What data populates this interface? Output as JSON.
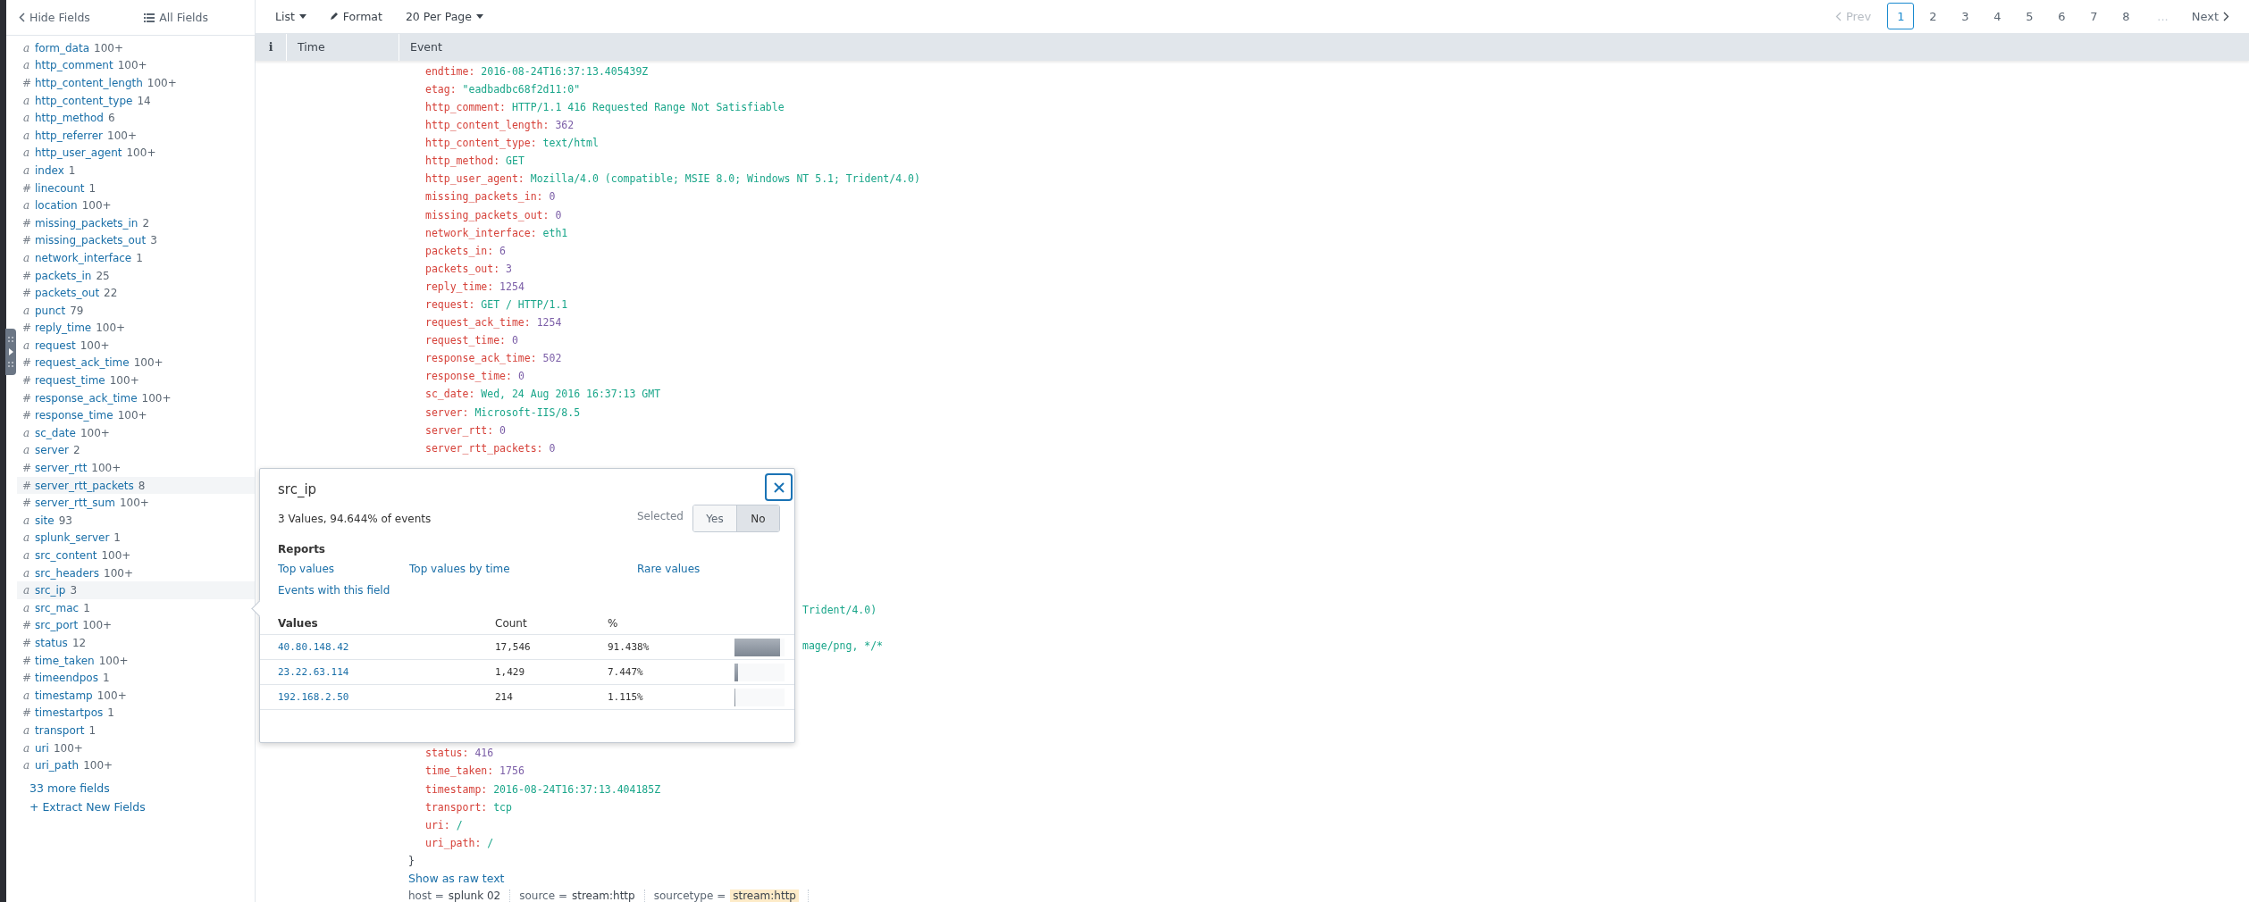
{
  "sidebar": {
    "hide_fields": "Hide Fields",
    "all_fields": "All Fields",
    "fields": [
      {
        "type": "a",
        "name": "form_data",
        "count": "100+",
        "highlighted": false
      },
      {
        "type": "a",
        "name": "http_comment",
        "count": "100+",
        "highlighted": false
      },
      {
        "type": "#",
        "name": "http_content_length",
        "count": "100+",
        "highlighted": false
      },
      {
        "type": "a",
        "name": "http_content_type",
        "count": "14",
        "highlighted": false
      },
      {
        "type": "a",
        "name": "http_method",
        "count": "6",
        "highlighted": false
      },
      {
        "type": "a",
        "name": "http_referrer",
        "count": "100+",
        "highlighted": false
      },
      {
        "type": "a",
        "name": "http_user_agent",
        "count": "100+",
        "highlighted": false
      },
      {
        "type": "a",
        "name": "index",
        "count": "1",
        "highlighted": false
      },
      {
        "type": "#",
        "name": "linecount",
        "count": "1",
        "highlighted": false
      },
      {
        "type": "a",
        "name": "location",
        "count": "100+",
        "highlighted": false
      },
      {
        "type": "#",
        "name": "missing_packets_in",
        "count": "2",
        "highlighted": false
      },
      {
        "type": "#",
        "name": "missing_packets_out",
        "count": "3",
        "highlighted": false
      },
      {
        "type": "a",
        "name": "network_interface",
        "count": "1",
        "highlighted": false
      },
      {
        "type": "#",
        "name": "packets_in",
        "count": "25",
        "highlighted": false
      },
      {
        "type": "#",
        "name": "packets_out",
        "count": "22",
        "highlighted": false
      },
      {
        "type": "a",
        "name": "punct",
        "count": "79",
        "highlighted": false
      },
      {
        "type": "#",
        "name": "reply_time",
        "count": "100+",
        "highlighted": false
      },
      {
        "type": "a",
        "name": "request",
        "count": "100+",
        "highlighted": false
      },
      {
        "type": "#",
        "name": "request_ack_time",
        "count": "100+",
        "highlighted": false
      },
      {
        "type": "#",
        "name": "request_time",
        "count": "100+",
        "highlighted": false
      },
      {
        "type": "#",
        "name": "response_ack_time",
        "count": "100+",
        "highlighted": false
      },
      {
        "type": "#",
        "name": "response_time",
        "count": "100+",
        "highlighted": false
      },
      {
        "type": "a",
        "name": "sc_date",
        "count": "100+",
        "highlighted": false
      },
      {
        "type": "a",
        "name": "server",
        "count": "2",
        "highlighted": false
      },
      {
        "type": "#",
        "name": "server_rtt",
        "count": "100+",
        "highlighted": false
      },
      {
        "type": "#",
        "name": "server_rtt_packets",
        "count": "8",
        "highlighted": true
      },
      {
        "type": "#",
        "name": "server_rtt_sum",
        "count": "100+",
        "highlighted": false
      },
      {
        "type": "a",
        "name": "site",
        "count": "93",
        "highlighted": false
      },
      {
        "type": "a",
        "name": "splunk_server",
        "count": "1",
        "highlighted": false
      },
      {
        "type": "a",
        "name": "src_content",
        "count": "100+",
        "highlighted": false
      },
      {
        "type": "a",
        "name": "src_headers",
        "count": "100+",
        "highlighted": false
      },
      {
        "type": "a",
        "name": "src_ip",
        "count": "3",
        "highlighted": true
      },
      {
        "type": "a",
        "name": "src_mac",
        "count": "1",
        "highlighted": false
      },
      {
        "type": "#",
        "name": "src_port",
        "count": "100+",
        "highlighted": false
      },
      {
        "type": "#",
        "name": "status",
        "count": "12",
        "highlighted": false
      },
      {
        "type": "#",
        "name": "time_taken",
        "count": "100+",
        "highlighted": false
      },
      {
        "type": "#",
        "name": "timeendpos",
        "count": "1",
        "highlighted": false
      },
      {
        "type": "a",
        "name": "timestamp",
        "count": "100+",
        "highlighted": false
      },
      {
        "type": "#",
        "name": "timestartpos",
        "count": "1",
        "highlighted": false
      },
      {
        "type": "a",
        "name": "transport",
        "count": "1",
        "highlighted": false
      },
      {
        "type": "a",
        "name": "uri",
        "count": "100+",
        "highlighted": false
      },
      {
        "type": "a",
        "name": "uri_path",
        "count": "100+",
        "highlighted": false
      }
    ],
    "more_fields": "33 more fields",
    "extract": "+ Extract New Fields"
  },
  "toolbar": {
    "list": "List",
    "format": "Format",
    "per_page": "20 Per Page"
  },
  "pagination": {
    "prev": "Prev",
    "pages": [
      {
        "label": "1",
        "selected": true
      },
      {
        "label": "2",
        "selected": false
      },
      {
        "label": "3",
        "selected": false
      },
      {
        "label": "4",
        "selected": false
      },
      {
        "label": "5",
        "selected": false
      },
      {
        "label": "6",
        "selected": false
      },
      {
        "label": "7",
        "selected": false
      },
      {
        "label": "8",
        "selected": false
      }
    ],
    "ellipsis": "...",
    "next": "Next"
  },
  "table": {
    "columns": [
      "i",
      "Time",
      "Event"
    ]
  },
  "event": {
    "lines_top": [
      {
        "key": "endtime:",
        "value": "2016-08-24T16:37:13.405439Z",
        "kind": "string"
      },
      {
        "key": "etag:",
        "value": "\"eadbadbc68f2d11:0\"",
        "kind": "string"
      },
      {
        "key": "http_comment:",
        "value": "HTTP/1.1 416 Requested Range Not Satisfiable",
        "kind": "string"
      },
      {
        "key": "http_content_length:",
        "value": "362",
        "kind": "number"
      },
      {
        "key": "http_content_type:",
        "value": "text/html",
        "kind": "string"
      },
      {
        "key": "http_method:",
        "value": "GET",
        "kind": "string"
      },
      {
        "key": "http_user_agent:",
        "value": "Mozilla/4.0 (compatible; MSIE 8.0; Windows NT 5.1; Trident/4.0)",
        "kind": "string"
      },
      {
        "key": "missing_packets_in:",
        "value": "0",
        "kind": "number"
      },
      {
        "key": "missing_packets_out:",
        "value": "0",
        "kind": "number"
      },
      {
        "key": "network_interface:",
        "value": "eth1",
        "kind": "string"
      },
      {
        "key": "packets_in:",
        "value": "6",
        "kind": "number"
      },
      {
        "key": "packets_out:",
        "value": "3",
        "kind": "number"
      },
      {
        "key": "reply_time:",
        "value": "1254",
        "kind": "number"
      },
      {
        "key": "request:",
        "value": "GET / HTTP/1.1",
        "kind": "string"
      },
      {
        "key": "request_ack_time:",
        "value": "1254",
        "kind": "number"
      },
      {
        "key": "request_time:",
        "value": "0",
        "kind": "number"
      },
      {
        "key": "response_ack_time:",
        "value": "502",
        "kind": "number"
      },
      {
        "key": "response_time:",
        "value": "0",
        "kind": "number"
      },
      {
        "key": "sc_date:",
        "value": "Wed, 24 Aug 2016 16:37:13 GMT",
        "kind": "string"
      },
      {
        "key": "server:",
        "value": "Microsoft-IIS/8.5",
        "kind": "string"
      },
      {
        "key": "server_rtt:",
        "value": "0",
        "kind": "number"
      },
      {
        "key": "server_rtt_packets:",
        "value": "0",
        "kind": "number"
      }
    ],
    "fragments": [
      "Trident/4.0)",
      "mage/png, */*"
    ],
    "lines_bottom": [
      {
        "key": "status:",
        "value": "416",
        "kind": "number"
      },
      {
        "key": "time_taken:",
        "value": "1756",
        "kind": "number"
      },
      {
        "key": "timestamp:",
        "value": "2016-08-24T16:37:13.404185Z",
        "kind": "string"
      },
      {
        "key": "transport:",
        "value": "tcp",
        "kind": "string"
      },
      {
        "key": "uri:",
        "value": "/",
        "kind": "string"
      },
      {
        "key": "uri_path:",
        "value": "/",
        "kind": "string"
      }
    ],
    "close_brace": "}",
    "raw_text": "Show as raw text",
    "meta": [
      {
        "label": "host =",
        "value": "splunk 02",
        "highlighted": false
      },
      {
        "label": "source =",
        "value": "stream:http",
        "highlighted": false
      },
      {
        "label": "sourcetype =",
        "value": "stream:http",
        "highlighted": true
      }
    ]
  },
  "popup": {
    "title": "src_ip",
    "summary": "3 Values, 94.644% of events",
    "selected_label": "Selected",
    "options": [
      {
        "label": "Yes",
        "selected": false
      },
      {
        "label": "No",
        "selected": true
      }
    ],
    "reports_title": "Reports",
    "reports": [
      "Top values",
      "Top values by time",
      "Rare values",
      "Events with this field"
    ],
    "columns": [
      "Values",
      "Count",
      "%"
    ],
    "rows": [
      {
        "value": "40.80.148.42",
        "count": "17,546",
        "percent": "91.438%",
        "level": 0.914
      },
      {
        "value": "23.22.63.114",
        "count": "1,429",
        "percent": "7.447%",
        "level": 0.074
      },
      {
        "value": "192.168.2.50",
        "count": "214",
        "percent": "1.115%",
        "level": 0.011
      }
    ]
  }
}
